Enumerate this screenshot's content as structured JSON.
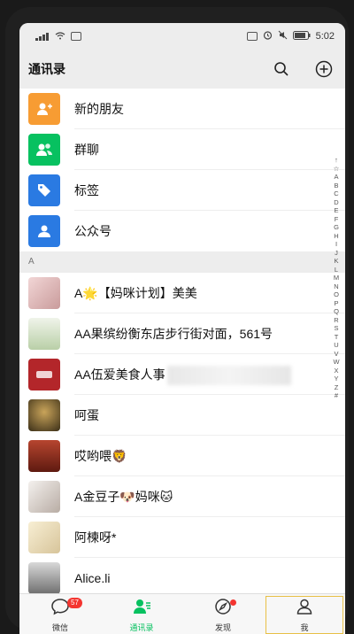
{
  "status": {
    "time": "5:02"
  },
  "header": {
    "title": "通讯录"
  },
  "functions": [
    {
      "label": "新的朋友",
      "color": "#f79c33",
      "icon": "add-friend-icon"
    },
    {
      "label": "群聊",
      "color": "#07c160",
      "icon": "group-chat-icon"
    },
    {
      "label": "标签",
      "color": "#2a7ae2",
      "icon": "tag-icon"
    },
    {
      "label": "公众号",
      "color": "#2a7ae2",
      "icon": "official-account-icon"
    }
  ],
  "section_letter": "A",
  "contacts": [
    {
      "name": "A🌟【妈咪计划】美美",
      "avatar_color": "#e8c7c7"
    },
    {
      "name": "AA果缤纷衡东店步行街对面，561号",
      "avatar_color": "#d8e2cf"
    },
    {
      "name": "AA伍爱美食人事",
      "avatar_color": "#b3262a"
    },
    {
      "name": "呵蛋",
      "avatar_color": "#5a4a2a"
    },
    {
      "name": "哎哟喂🦁",
      "avatar_color": "#8a2c1e"
    },
    {
      "name": "A金豆子🐶妈咪🐱",
      "avatar_color": "#d9d4d0"
    },
    {
      "name": "阿楝呀*",
      "avatar_color": "#efe4c5"
    },
    {
      "name": "Alice.li",
      "avatar_color": "#9a9a9a"
    }
  ],
  "alphabet": [
    "↑",
    "☆",
    "A",
    "B",
    "C",
    "D",
    "E",
    "F",
    "G",
    "H",
    "I",
    "J",
    "K",
    "L",
    "M",
    "N",
    "O",
    "P",
    "Q",
    "R",
    "S",
    "T",
    "U",
    "V",
    "W",
    "X",
    "Y",
    "Z",
    "#"
  ],
  "tabs": [
    {
      "label": "微信",
      "badge": "57"
    },
    {
      "label": "通讯录"
    },
    {
      "label": "发现"
    },
    {
      "label": "我"
    }
  ]
}
